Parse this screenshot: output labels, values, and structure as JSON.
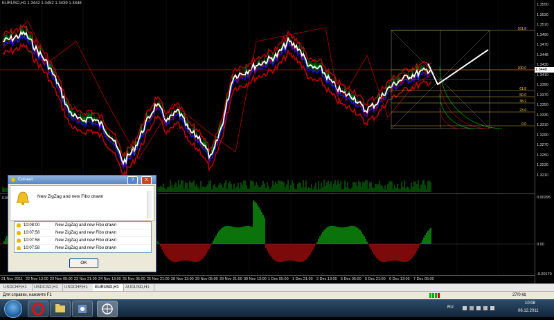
{
  "chart": {
    "symbol_title": "EURUSD,H1  1.3442 1.3452 1.3439 1.3448",
    "sub_label": "0.00",
    "current_price": "1.3448",
    "price_scale": [
      "1.3550",
      "1.3530",
      "1.3510",
      "1.3490",
      "1.3470",
      "1.3448",
      "1.3430",
      "1.3410",
      "1.3390",
      "1.3370",
      "1.3350",
      "1.3330",
      "1.3310",
      "1.3290",
      "1.3270",
      "1.3250",
      "1.3230",
      "1.3210"
    ],
    "osc_scale": [
      "0.00295",
      "0.00",
      "-0.00170"
    ],
    "fib_levels": [
      "161.8",
      "100.0",
      "61.8",
      "50.0",
      "38.2",
      "23.6",
      "0.0"
    ],
    "dates": [
      "21 Nov 2011",
      "22 Nov 13:00",
      "23 Nov 05:00",
      "23 Nov 21:00",
      "24 Nov 13:00",
      "25 Nov 05:00",
      "25 Nov 21:00",
      "28 Nov 13:00",
      "29 Nov 05:00",
      "29 Nov 21:00",
      "30 Nov 13:00",
      "1 Dec 05:00",
      "1 Dec 21:00",
      "2 Dec 13:00",
      "5 Dec 05:00",
      "5 Dec 21:00",
      "6 Dec 13:00",
      "7 Dec 05:00"
    ],
    "colors": {
      "up": "#00c000",
      "down": "#e00000",
      "ma_white": "#ffffff",
      "ma_blue": "#1010e0",
      "ma_red": "#c00000",
      "zigzag": "#b00000"
    }
  },
  "tabs": [
    "USDCHF,H1",
    "USDCAD,H1",
    "USDCHF,H1",
    "EURUSD,H1",
    "AUDUSD,H1"
  ],
  "active_tab": 3,
  "status": {
    "help": "Для справки, нажмите F1",
    "traffic": "27/0 kb"
  },
  "dialog": {
    "title": "Сигнал",
    "help_btn": "?",
    "close_btn": "X",
    "message": "New ZigZag and new Fibo drawn",
    "rows": [
      {
        "time": "10:08:00",
        "msg": "New ZigZag and new Fibo drawn"
      },
      {
        "time": "10:07:58",
        "msg": "New ZigZag and new Fibo drawn"
      },
      {
        "time": "10:07:58",
        "msg": "New ZigZag and new Fibo drawn"
      },
      {
        "time": "10:07:58",
        "msg": "New ZigZag and new Fibo drawn"
      }
    ],
    "ok_label": "OK"
  },
  "taskbar": {
    "lang": "RU",
    "time": "10:08",
    "date": "06.12.2011"
  }
}
